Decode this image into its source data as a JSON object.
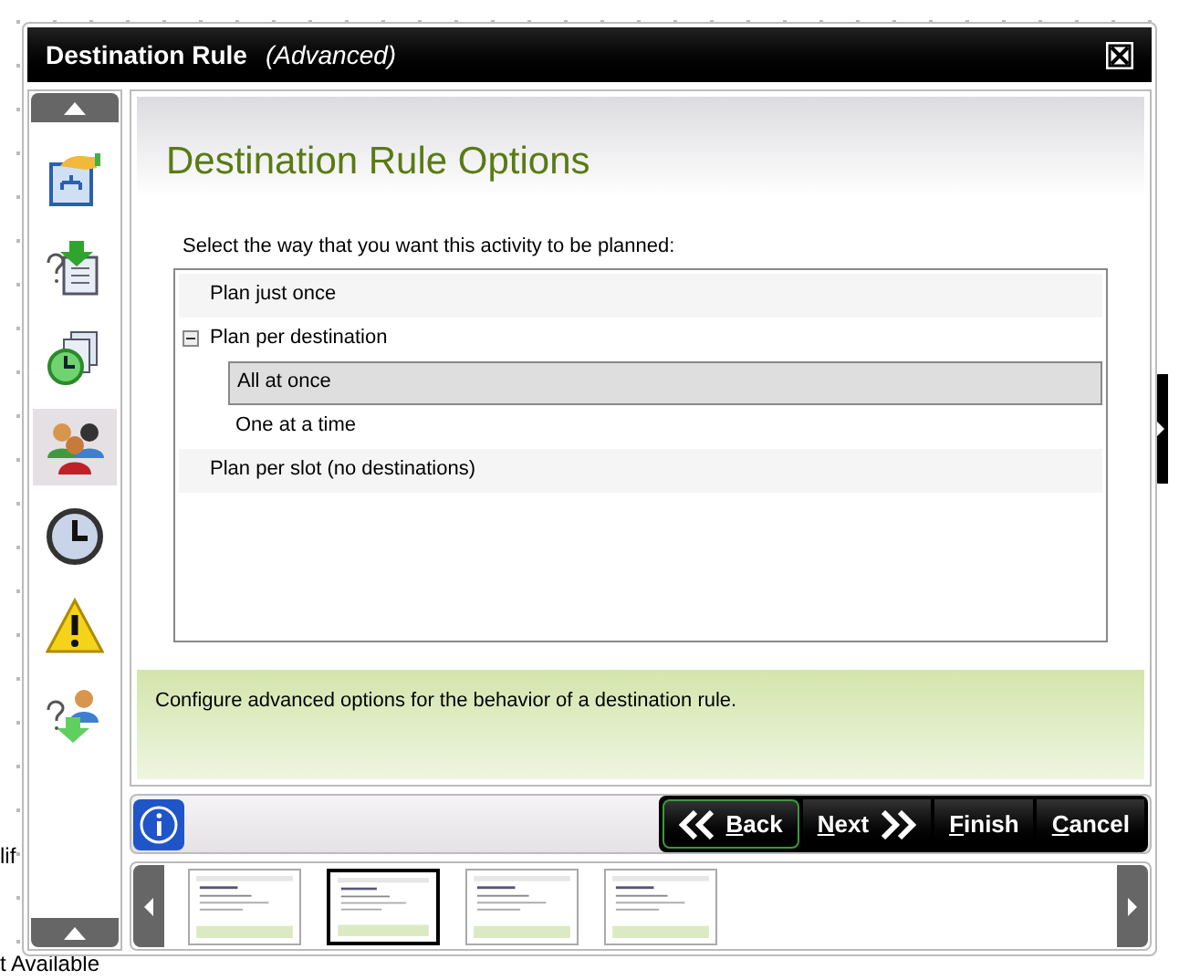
{
  "background_texts": [
    "lif",
    "t Available"
  ],
  "window": {
    "title": "Destination Rule",
    "subtitle": "(Advanced)"
  },
  "sidebar": {
    "items": [
      {
        "selected": false
      },
      {
        "selected": false
      },
      {
        "selected": false
      },
      {
        "selected": true
      },
      {
        "selected": false
      },
      {
        "selected": false
      },
      {
        "selected": false
      }
    ]
  },
  "page": {
    "heading": "Destination Rule Options",
    "prompt": "Select the way that you want this activity to be planned:",
    "tree": [
      {
        "label": "Plan just once",
        "selected": false
      },
      {
        "label": "Plan per destination",
        "selected": false,
        "expanded": true,
        "children": [
          {
            "label": "All at once",
            "selected": true
          },
          {
            "label": "One at a time",
            "selected": false
          }
        ]
      },
      {
        "label": "Plan per slot (no destinations)",
        "selected": false
      }
    ],
    "description": "Configure advanced options for the behavior of a destination rule."
  },
  "buttons": [
    {
      "label": "Back",
      "kind": "back",
      "focused": true
    },
    {
      "label": "Next",
      "kind": "next",
      "focused": false
    },
    {
      "label": "Finish",
      "kind": "plain",
      "focused": false
    },
    {
      "label": "Cancel",
      "kind": "plain",
      "focused": false
    }
  ],
  "thumbnails": [
    {
      "selected": false
    },
    {
      "selected": true
    },
    {
      "selected": false
    },
    {
      "selected": false
    }
  ]
}
